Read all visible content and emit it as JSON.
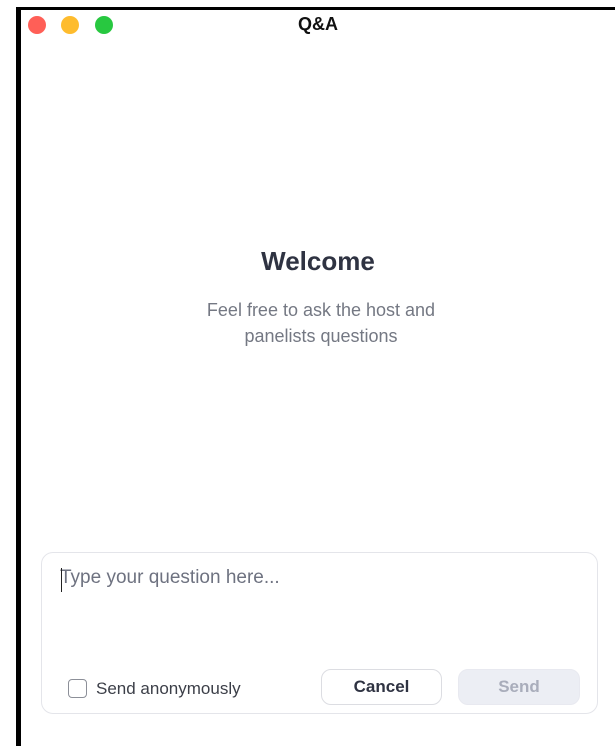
{
  "window": {
    "title": "Q&A"
  },
  "traffic_lights": {
    "close": "#ff5f57",
    "minimize": "#febc2e",
    "zoom": "#28c840"
  },
  "main": {
    "heading": "Welcome",
    "subtitle_line1": "Feel free to ask the host and",
    "subtitle_line2": "panelists questions"
  },
  "composer": {
    "input_value": "",
    "input_placeholder": "Type your question here...",
    "anonymous_label": "Send anonymously",
    "anonymous_checked": false,
    "cancel_label": "Cancel",
    "send_label": "Send",
    "send_enabled": false
  }
}
